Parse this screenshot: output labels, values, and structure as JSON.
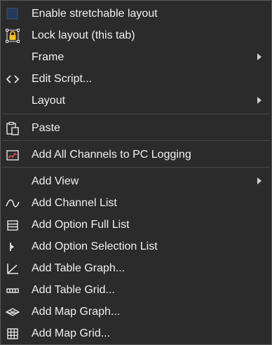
{
  "menu": {
    "items": [
      {
        "label": "Enable stretchable layout",
        "icon": "checkbox-unchecked-icon"
      },
      {
        "label": "Lock layout (this tab)",
        "icon": "lock-layout-icon"
      },
      {
        "label": "Frame",
        "icon": "",
        "submenu": true
      },
      {
        "label": "Edit Script...",
        "icon": "code-brackets-icon"
      },
      {
        "label": "Layout",
        "icon": "",
        "submenu": true
      },
      {
        "label": "Paste",
        "icon": "clipboard-paste-icon"
      },
      {
        "label": "Add All Channels to PC Logging",
        "icon": "chart-logging-icon"
      },
      {
        "label": "Add View",
        "icon": "",
        "submenu": true
      },
      {
        "label": "Add Channel List",
        "icon": "wave-icon"
      },
      {
        "label": "Add Option Full List",
        "icon": "list-icon"
      },
      {
        "label": "Add Option Selection List",
        "icon": "selection-marker-icon"
      },
      {
        "label": "Add Table Graph...",
        "icon": "graph-axes-icon"
      },
      {
        "label": "Add Table Grid...",
        "icon": "table-row-icon"
      },
      {
        "label": "Add Map Graph...",
        "icon": "map-3d-icon"
      },
      {
        "label": "Add Map Grid...",
        "icon": "grid-icon"
      }
    ]
  },
  "colors": {
    "background": "#2b2b2b",
    "text": "#f0f0f0",
    "separator": "#474747",
    "border": "#5a5a5a",
    "lock_yellow": "#f2c21b"
  }
}
